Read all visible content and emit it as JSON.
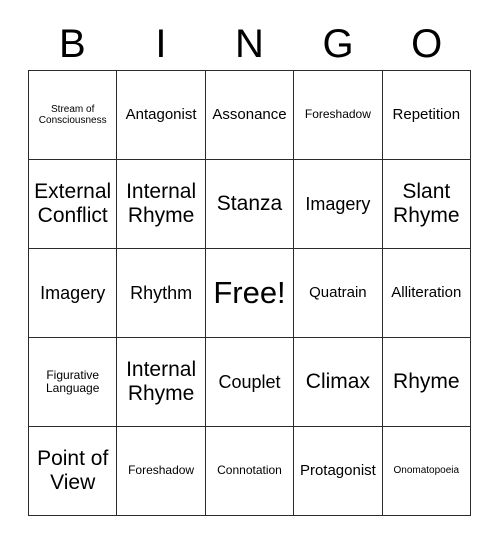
{
  "card": {
    "header": {
      "letters": [
        "B",
        "I",
        "N",
        "G",
        "O"
      ]
    },
    "columns": 5,
    "rows": 5,
    "colors": {
      "background": "#ffffff",
      "grid_line": "#2b2b2b",
      "text": "#000000"
    },
    "cells": [
      [
        {
          "label": "Stream of Consciousness",
          "size": "fs-xs",
          "free": false
        },
        {
          "label": "Antagonist",
          "size": "fs-md",
          "free": false
        },
        {
          "label": "Assonance",
          "size": "fs-md",
          "free": false
        },
        {
          "label": "Foreshadow",
          "size": "fs-sm",
          "free": false
        },
        {
          "label": "Repetition",
          "size": "fs-md",
          "free": false
        }
      ],
      [
        {
          "label": "External Conflict",
          "size": "fs-xl",
          "free": false
        },
        {
          "label": "Internal Rhyme",
          "size": "fs-xl",
          "free": false
        },
        {
          "label": "Stanza",
          "size": "fs-xl",
          "free": false
        },
        {
          "label": "Imagery",
          "size": "fs-lg",
          "free": false
        },
        {
          "label": "Slant Rhyme",
          "size": "fs-xl",
          "free": false
        }
      ],
      [
        {
          "label": "Imagery",
          "size": "fs-lg",
          "free": false
        },
        {
          "label": "Rhythm",
          "size": "fs-lg",
          "free": false
        },
        {
          "label": "Free!",
          "size": "fs-xxl",
          "free": true
        },
        {
          "label": "Quatrain",
          "size": "fs-md",
          "free": false
        },
        {
          "label": "Alliteration",
          "size": "fs-md",
          "free": false
        }
      ],
      [
        {
          "label": "Figurative Language",
          "size": "fs-sm",
          "free": false
        },
        {
          "label": "Internal Rhyme",
          "size": "fs-xl",
          "free": false
        },
        {
          "label": "Couplet",
          "size": "fs-lg",
          "free": false
        },
        {
          "label": "Climax",
          "size": "fs-xl",
          "free": false
        },
        {
          "label": "Rhyme",
          "size": "fs-xl",
          "free": false
        }
      ],
      [
        {
          "label": "Point of View",
          "size": "fs-xl",
          "free": false
        },
        {
          "label": "Foreshadow",
          "size": "fs-sm",
          "free": false
        },
        {
          "label": "Connotation",
          "size": "fs-sm",
          "free": false
        },
        {
          "label": "Protagonist",
          "size": "fs-md",
          "free": false
        },
        {
          "label": "Onomatopoeia",
          "size": "fs-xs",
          "free": false
        }
      ]
    ]
  }
}
